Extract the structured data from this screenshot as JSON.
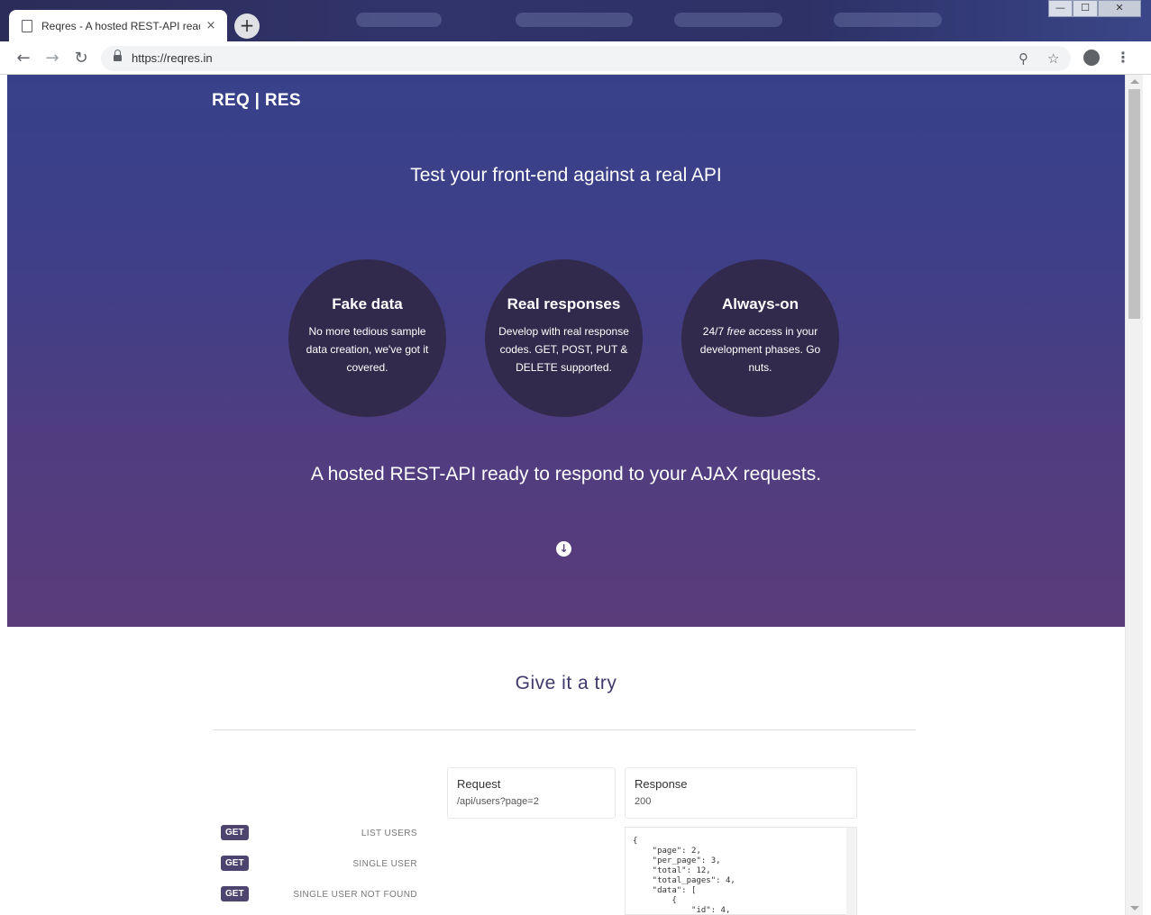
{
  "browser": {
    "tab_title": "Reqres - A hosted REST-API ready to respond to your AJAX requests",
    "tab_close": "×",
    "new_tab": "+",
    "url": "https://reqres.in",
    "back": "←",
    "forward": "→",
    "reload": "↻",
    "zoom_icon": "⚲",
    "star_icon": "☆",
    "menu_icon": "⋮",
    "minimize": "—",
    "maximize": "☐",
    "close": "✕"
  },
  "hero": {
    "logo": "REQ | RES",
    "tagline": "Test your front-end against a real API",
    "features": [
      {
        "title": "Fake data",
        "text": "No more tedious sample data creation, we've got it covered."
      },
      {
        "title": "Real responses",
        "text": "Develop with real response codes. GET, POST, PUT & DELETE supported."
      },
      {
        "title": "Always-on",
        "text_before": "24/7 ",
        "text_em": "free",
        "text_after": " access in your development phases. Go nuts."
      }
    ],
    "subtitle": "A hosted REST-API ready to respond to your AJAX requests.",
    "down_icon": "↓"
  },
  "try": {
    "title": "Give it a try",
    "endpoints": [
      {
        "method": "GET",
        "label": "LIST USERS"
      },
      {
        "method": "GET",
        "label": "SINGLE USER"
      },
      {
        "method": "GET",
        "label": "SINGLE USER NOT FOUND"
      }
    ],
    "request": {
      "title": "Request",
      "value": "/api/users?page=2"
    },
    "response": {
      "title": "Response",
      "value": "200"
    },
    "code_lines": [
      "{",
      "    \"page\": 2,",
      "    \"per_page\": 3,",
      "    \"total\": 12,",
      "    \"total_pages\": 4,",
      "    \"data\": [",
      "        {",
      "            \"id\": 4,"
    ]
  }
}
